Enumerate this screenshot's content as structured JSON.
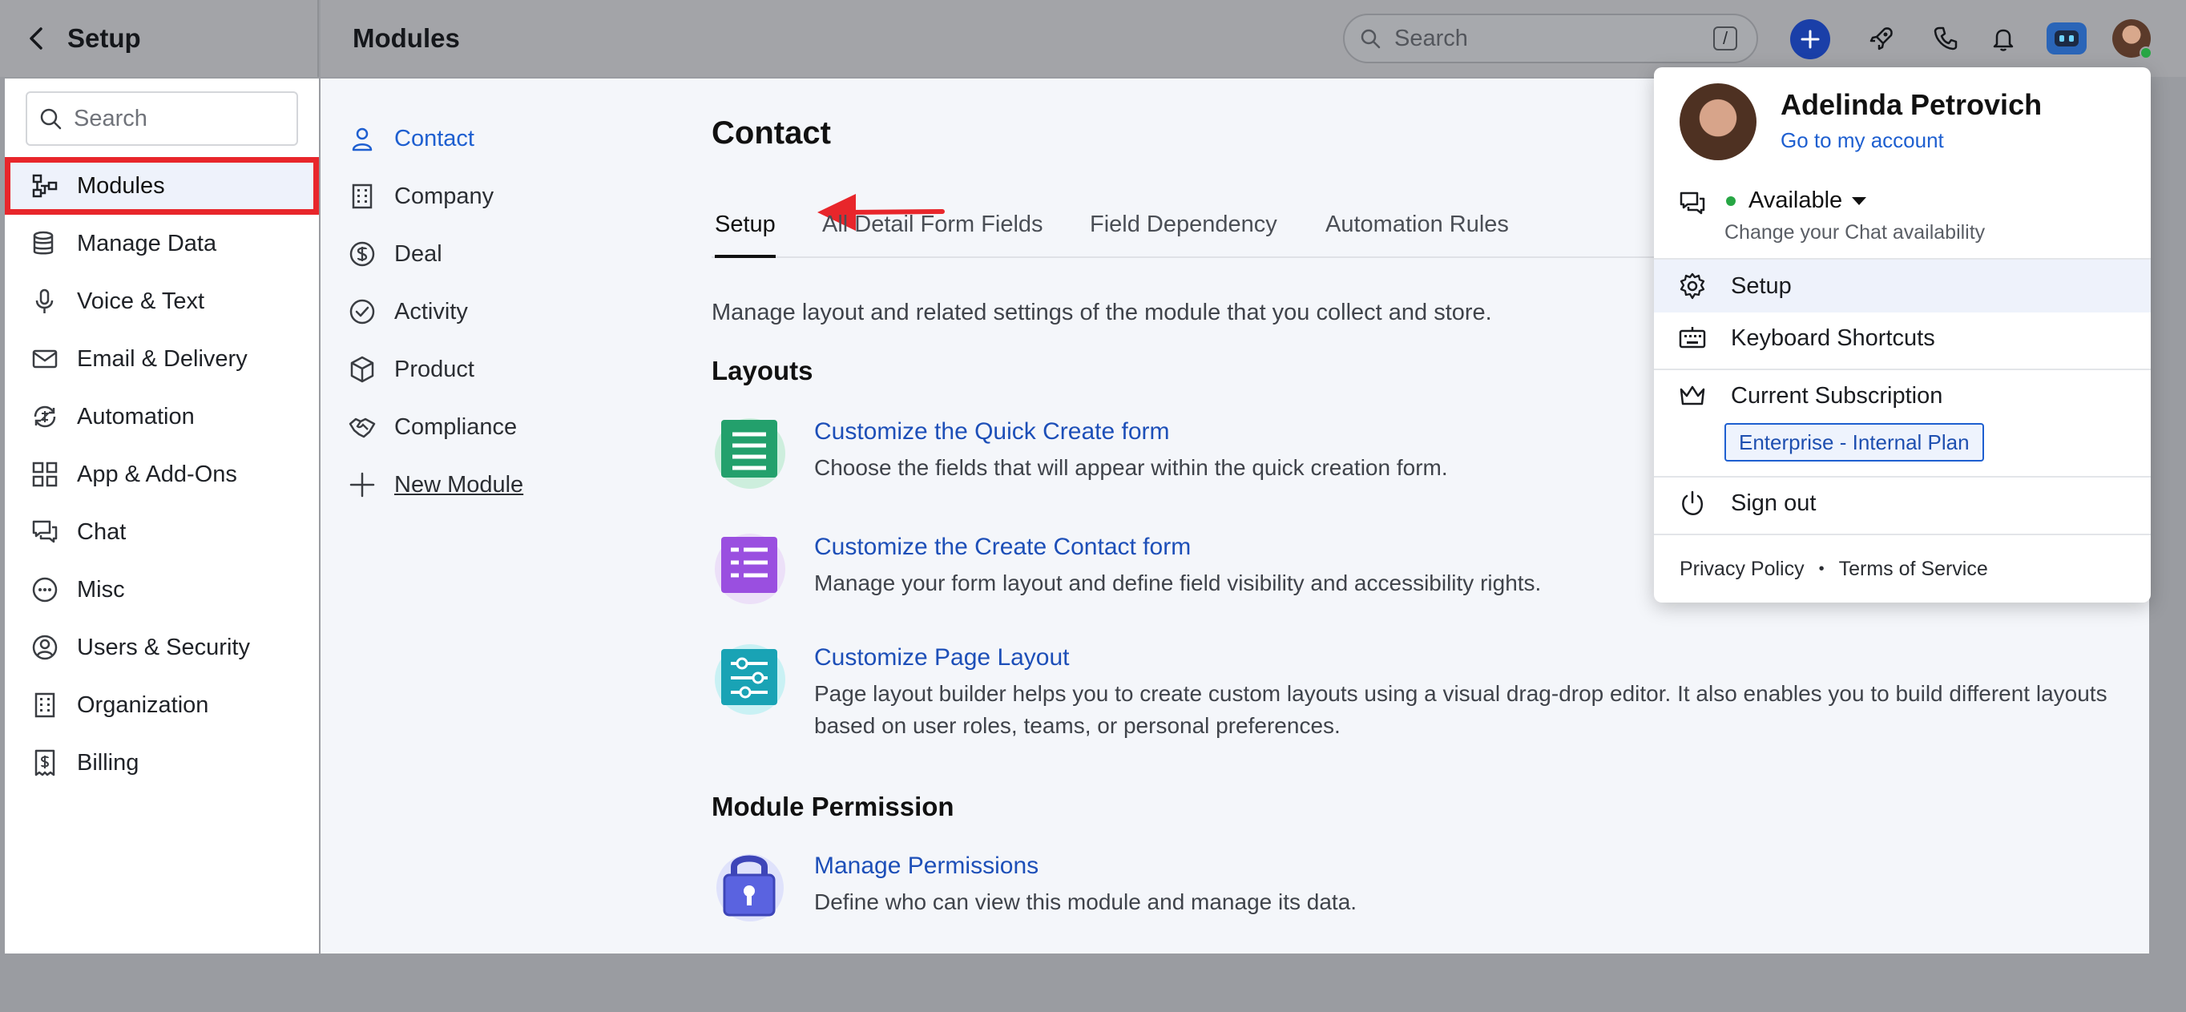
{
  "setup_header": {
    "title": "Setup"
  },
  "header": {
    "title": "Modules",
    "search_placeholder": "Search",
    "search_shortcut": "/"
  },
  "sidebar": {
    "search_placeholder": "Search",
    "items": [
      {
        "label": "Modules",
        "icon": "modules-icon",
        "active": true
      },
      {
        "label": "Manage Data",
        "icon": "database-icon"
      },
      {
        "label": "Voice & Text",
        "icon": "microphone-icon"
      },
      {
        "label": "Email & Delivery",
        "icon": "mail-icon"
      },
      {
        "label": "Automation",
        "icon": "automation-icon"
      },
      {
        "label": "App & Add-Ons",
        "icon": "apps-grid-icon"
      },
      {
        "label": "Chat",
        "icon": "chat-icon"
      },
      {
        "label": "Misc",
        "icon": "more-circle-icon"
      },
      {
        "label": "Users & Security",
        "icon": "user-circle-icon"
      },
      {
        "label": "Organization",
        "icon": "building-icon"
      },
      {
        "label": "Billing",
        "icon": "receipt-icon"
      }
    ]
  },
  "modules": {
    "items": [
      {
        "label": "Contact",
        "icon": "person-icon",
        "active": true
      },
      {
        "label": "Company",
        "icon": "building-icon"
      },
      {
        "label": "Deal",
        "icon": "dollar-circle-icon"
      },
      {
        "label": "Activity",
        "icon": "check-circle-icon"
      },
      {
        "label": "Product",
        "icon": "box-icon"
      },
      {
        "label": "Compliance",
        "icon": "handshake-icon"
      }
    ],
    "new_module": "New Module"
  },
  "main": {
    "title": "Contact",
    "tabs": [
      "Setup",
      "All Detail Form Fields",
      "Field Dependency",
      "Automation Rules"
    ],
    "active_tab": "Setup",
    "description": "Manage layout and related settings of the module that you collect and store.",
    "layouts_heading": "Layouts",
    "cards": [
      {
        "title": "Customize the Quick Create form",
        "desc": "Choose the fields that will appear within the quick creation form.",
        "icon": "green-form-icon"
      },
      {
        "title": "Customize the Create Contact form",
        "desc": "Manage your form layout and define field visibility and accessibility rights.",
        "icon": "purple-form-icon"
      },
      {
        "title": "Customize Page Layout",
        "desc": "Page layout builder helps you to create custom layouts using a visual drag-drop editor. It also enables you to build different layouts based on user roles, teams, or personal preferences.",
        "icon": "teal-sliders-icon"
      }
    ],
    "permission_heading": "Module Permission",
    "permission_card": {
      "title": "Manage Permissions",
      "desc": "Define who can view this module and manage its data.",
      "icon": "lock-icon"
    }
  },
  "user_menu": {
    "name": "Adelinda Petrovich",
    "account_link": "Go to my account",
    "availability": "Available",
    "availability_sub": "Change your Chat availability",
    "setup": "Setup",
    "shortcuts": "Keyboard Shortcuts",
    "subscription": "Current Subscription",
    "plan": "Enterprise - Internal Plan",
    "sign_out": "Sign out",
    "privacy": "Privacy Policy",
    "terms": "Terms of Service"
  },
  "colors": {
    "accent": "#1e5fd0",
    "highlight": "#e8262b",
    "status_online": "#27a644"
  }
}
